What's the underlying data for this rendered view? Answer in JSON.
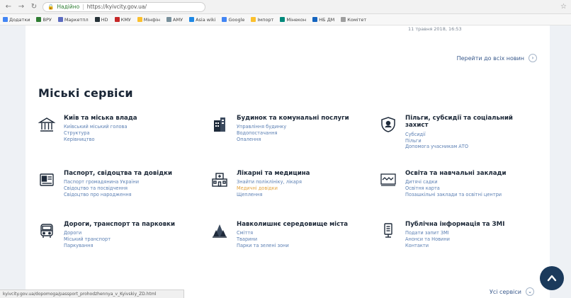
{
  "browser": {
    "security_label": "Надійно",
    "url": "https://kyivcity.gov.ua/"
  },
  "bookmarks": [
    {
      "label": "Додатки",
      "color": "#4285f4"
    },
    {
      "label": "ВРУ",
      "color": "#2e7d32"
    },
    {
      "label": "Маркетпл",
      "color": "#5c6bc0"
    },
    {
      "label": "HD",
      "color": "#263238"
    },
    {
      "label": "КМУ",
      "color": "#c62828"
    },
    {
      "label": "Мінфін",
      "color": "#fbc02d"
    },
    {
      "label": "АМУ",
      "color": "#78909c"
    },
    {
      "label": "Asia wiki",
      "color": "#1e88e5"
    },
    {
      "label": "Google",
      "color": "#4285f4"
    },
    {
      "label": "Імпорт",
      "color": "#fbc02d"
    },
    {
      "label": "Мінекон",
      "color": "#00897b"
    },
    {
      "label": "НБ ДМ",
      "color": "#1565c0"
    },
    {
      "label": "Комітет",
      "color": "#9e9e9e"
    }
  ],
  "page": {
    "date_text": "11 травня 2018, 16:53",
    "all_news": "Перейти до всіх новин",
    "section_title": "Міські сервіси",
    "all_services": "Усі сервіси",
    "status_url": "kyivcity.gov.ua/dopomoga/passport_prohodzhennya_v_Kyivskiy_ZD.html"
  },
  "services": [
    {
      "title": "Київ та міська влада",
      "icon": "city-hall-icon",
      "links": [
        "Київський міський голова",
        "Структура",
        "Керівництво"
      ]
    },
    {
      "title": "Будинок та комунальні послуги",
      "icon": "building-icon",
      "links": [
        "Управління будинку",
        "Водопостачання",
        "Опалення"
      ]
    },
    {
      "title": "Пільги, субсидії та соціальний захист",
      "icon": "shield-icon",
      "links": [
        "Субсидії",
        "Пільги",
        "Допомога учасникам АТО"
      ]
    },
    {
      "title": "Паспорт, свідоцтва та довідки",
      "icon": "passport-icon",
      "links": [
        "Паспорт громадянина України",
        "Свідоцтво та посвідчення",
        "Свідоцтво про народження"
      ]
    },
    {
      "title": "Лікарні та медицина",
      "icon": "hospital-icon",
      "links": [
        "Знайти поліклініку, лікаря",
        "Медичні довідки",
        "Щеплення"
      ]
    },
    {
      "title": "Освіта та навчальні заклади",
      "icon": "education-icon",
      "links": [
        "Дитячі садки",
        "Освітня карта",
        "Позашкільні заклади та освітні центри"
      ]
    },
    {
      "title": "Дороги, транспорт та парковки",
      "icon": "bus-icon",
      "links": [
        "Дороги",
        "Міський транспорт",
        "Паркування"
      ]
    },
    {
      "title": "Навколишнє середовище міста",
      "icon": "environment-icon",
      "links": [
        "Сміття",
        "Тварини",
        "Парки та зелені зони"
      ]
    },
    {
      "title": "Публічна інформація та ЗМІ",
      "icon": "info-icon",
      "links": [
        "Подати запит ЗМІ",
        "Анонси та Новини",
        "Контакти"
      ]
    }
  ]
}
